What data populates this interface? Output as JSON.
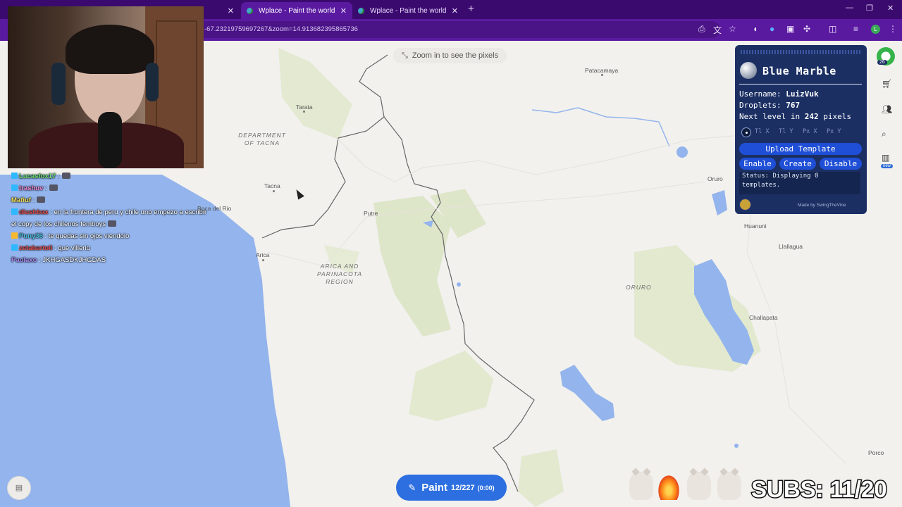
{
  "browser": {
    "tabs": [
      {
        "title": "",
        "active": false
      },
      {
        "title": "",
        "active": false
      },
      {
        "title": "Wplace - Paint the world",
        "active": true
      },
      {
        "title": "Wplace - Paint the world",
        "active": false
      }
    ],
    "new_tab_label": "+",
    "url": "-67.23219759697267&zoom=14.913682395865736",
    "profile_initial": "L"
  },
  "zoom_hint": "Zoom in to see the pixels",
  "map_labels": {
    "patacamaya": "Patacamaya",
    "tarata": "Tarata",
    "dept_tacna": [
      "DEPARTMENT",
      "OF TACNA"
    ],
    "tacna": "Tacna",
    "boca_del_rio": "Boca del Rio",
    "putre": "Putre",
    "arica": "Arica",
    "arica_region": [
      "ARICA AND",
      "PARINACOTA",
      "REGION"
    ],
    "oruro": "Oruro",
    "oruro_region": "ORURO",
    "huanuni": "Huanuni",
    "llallagua": "Llallagua",
    "challapata": "Challapata",
    "porco": "Porco"
  },
  "chat": [
    {
      "user": "Lucasfox17",
      "user_color": "#6fe36f",
      "message": ":"
    },
    {
      "user": "trashuv",
      "user_color": "#f08ad8",
      "message": ":"
    },
    {
      "user": "Mafiuf",
      "user_color": "#f5e35a",
      "message": ":"
    },
    {
      "user": "diushbax",
      "user_color": "#e24b4b",
      "message": ": en la frontera de peru y chile uno empezo a escribir el copy de los chilenos femboys"
    },
    {
      "user": "Puny36",
      "user_color": "#4bc3e2",
      "message": ": te quedas sin ojos viendolo"
    },
    {
      "user": "zetabartoli",
      "user_color": "#e24b4b",
      "message": ": que villerio"
    },
    {
      "user": "Paolaxo",
      "user_color": "#a78bf0",
      "message": ": JKHGASDKJHGDAS"
    }
  ],
  "blue_marble": {
    "title": "Blue Marble",
    "username_label": "Username:",
    "username": "LuizVuk",
    "droplets_label": "Droplets:",
    "droplets": "767",
    "next_level_prefix": "Next level in",
    "next_level_value": "242",
    "next_level_suffix": "pixels",
    "coord_placeholders": [
      "Tl X",
      "Tl Y",
      "Px X",
      "Px Y"
    ],
    "upload_label": "Upload Template",
    "enable_label": "Enable",
    "create_label": "Create",
    "disable_label": "Disable",
    "status_text": "Status: Displaying 0 templates.",
    "made_by": "Made by SwingTheVine"
  },
  "sidebar": {
    "level_badge": "26",
    "new_badge": "new"
  },
  "paint_button": {
    "label": "Paint",
    "charges": "12/227",
    "timer": "(0:00)"
  },
  "overlay": {
    "subs": "SUBS: 11/20"
  },
  "colors": {
    "brand_purple": "#5a1aa0",
    "panel_blue": "#1b2f63",
    "button_blue": "#1f4fd6",
    "paint_blue": "#2d6fe0",
    "water": "#93b4ec",
    "land": "#f2f1ee"
  }
}
